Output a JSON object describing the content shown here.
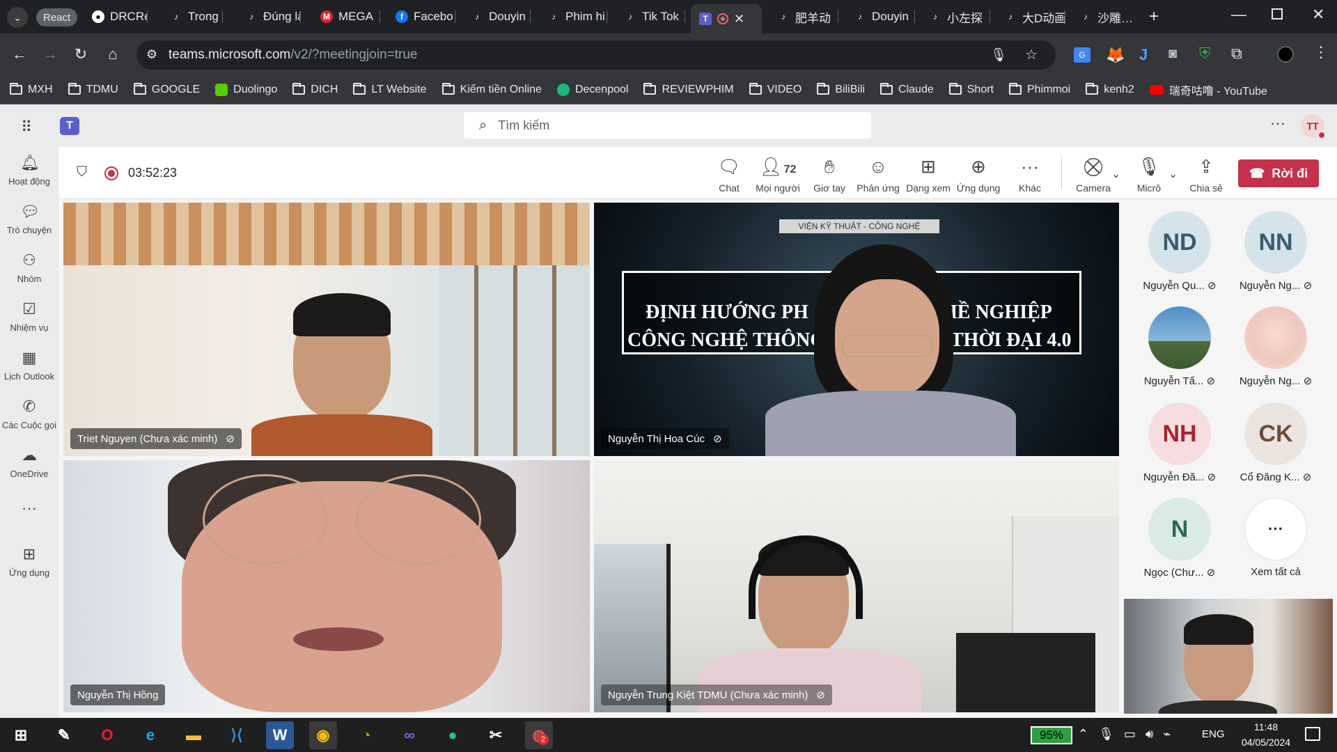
{
  "browser": {
    "tab_pill": "React",
    "tabs": [
      {
        "label": "DRCRec",
        "icon": "github-icon"
      },
      {
        "label": "Trong T",
        "icon": "tiktok-icon"
      },
      {
        "label": "Đúng là",
        "icon": "tiktok-icon"
      },
      {
        "label": "MEGA",
        "icon": "mega-icon"
      },
      {
        "label": "Facebo",
        "icon": "facebook-icon"
      },
      {
        "label": "Douyin",
        "icon": "tiktok-icon"
      },
      {
        "label": "Phim hi",
        "icon": "tiktok-icon"
      },
      {
        "label": "Tik Tok",
        "icon": "tiktok-icon"
      },
      {
        "label": "",
        "icon": "teams-icon"
      },
      {
        "label": "肥羊动",
        "icon": "tiktok-icon"
      },
      {
        "label": "Douyin",
        "icon": "tiktok-icon"
      },
      {
        "label": "小左探",
        "icon": "tiktok-icon"
      },
      {
        "label": "大D动画",
        "icon": "tiktok-icon"
      },
      {
        "label": "沙雕…",
        "icon": "tiktok-icon"
      }
    ],
    "url_host": "teams.microsoft.com",
    "url_path": "/v2/?meetingjoin=true",
    "bookmarks": [
      {
        "label": "MXH",
        "icon": "folder-icon"
      },
      {
        "label": "TDMU",
        "icon": "folder-icon"
      },
      {
        "label": "GOOGLE",
        "icon": "folder-icon"
      },
      {
        "label": "Duolingo",
        "icon": "duolingo-icon"
      },
      {
        "label": "DICH",
        "icon": "folder-icon"
      },
      {
        "label": "LT Website",
        "icon": "folder-icon"
      },
      {
        "label": "Kiếm tiền Online",
        "icon": "folder-icon"
      },
      {
        "label": "Decenpool",
        "icon": "decenpool-icon"
      },
      {
        "label": "REVIEWPHIM",
        "icon": "folder-icon"
      },
      {
        "label": "VIDEO",
        "icon": "folder-icon"
      },
      {
        "label": "BiliBili",
        "icon": "folder-icon"
      },
      {
        "label": "Claude",
        "icon": "folder-icon"
      },
      {
        "label": "Short",
        "icon": "folder-icon"
      },
      {
        "label": "Phimmoi",
        "icon": "folder-icon"
      },
      {
        "label": "kenh2",
        "icon": "folder-icon"
      },
      {
        "label": "瑞奇咕噜 - YouTube",
        "icon": "youtube-icon"
      }
    ]
  },
  "teams": {
    "search_placeholder": "Tìm kiếm",
    "user_initials": "TT",
    "rail": [
      {
        "label": "Hoạt động",
        "icon": "bell-icon"
      },
      {
        "label": "Trò chuyện",
        "icon": "chat-icon"
      },
      {
        "label": "Nhóm",
        "icon": "teams-group-icon"
      },
      {
        "label": "Nhiệm vụ",
        "icon": "tasks-icon"
      },
      {
        "label": "Lịch Outlook",
        "icon": "calendar-icon"
      },
      {
        "label": "Các Cuộc gọi",
        "icon": "phone-icon"
      },
      {
        "label": "OneDrive",
        "icon": "cloud-icon"
      },
      {
        "label": "",
        "icon": "more-icon"
      },
      {
        "label": "Ứng dụng",
        "icon": "add-app-icon"
      }
    ]
  },
  "meeting": {
    "timer": "03:52:23",
    "people_count": "72",
    "controls": {
      "chat": "Chat",
      "people": "Mọi người",
      "raise": "Giơ tay",
      "react": "Phản ứng",
      "view": "Dạng xem",
      "apps": "Ứng dụng",
      "more": "Khác",
      "camera": "Camera",
      "mic": "Micrô",
      "share": "Chia sẻ",
      "leave": "Rời đi"
    },
    "tiles": [
      {
        "name": "Triet Nguyen (Chưa xác minh)"
      },
      {
        "name": "Nguyễn Thị Hoa Cúc"
      },
      {
        "name": "Nguyễn Thị Hồng"
      },
      {
        "name": "Nguyễn Trung Kiệt TDMU (Chưa xác minh)"
      }
    ],
    "slide": {
      "banner": "VIỆN KỸ THUẬT - CÔNG NGHỆ",
      "line1": "ĐỊNH HƯỚNG PH",
      "line1b": "HỀ NGHIỆP",
      "line2": "CÔNG NGHỆ THÔNG",
      "line2b": "THỜI ĐẠI 4.0"
    },
    "roster": [
      {
        "initials": "ND",
        "name": "Nguyễn Qu...",
        "bg": "#d5e3ea",
        "fg": "#3b5b6c"
      },
      {
        "initials": "NN",
        "name": "Nguyễn Ng...",
        "bg": "#d5e3ea",
        "fg": "#3b5b6c"
      },
      {
        "initials": "",
        "name": "Nguyễn Tấ...",
        "bg": "#6a9fc6",
        "fg": "#fff"
      },
      {
        "initials": "",
        "name": "Nguyễn Ng...",
        "bg": "#f1d7d2",
        "fg": "#fff"
      },
      {
        "initials": "NH",
        "name": "Nguyễn Đă...",
        "bg": "#f6dde0",
        "fg": "#a4262c"
      },
      {
        "initials": "CK",
        "name": "Cổ Đăng K...",
        "bg": "#ece4df",
        "fg": "#6b4e3d"
      },
      {
        "initials": "N",
        "name": "Ngọc (Chư...",
        "bg": "#d9ebe4",
        "fg": "#2d6a4f"
      },
      {
        "initials": "···",
        "name": "Xem tất cả",
        "bg": "#ffffff",
        "fg": "#242424"
      }
    ]
  },
  "taskbar": {
    "battery": "95%",
    "lang": "ENG",
    "time": "11:48",
    "date": "04/05/2024",
    "badge": "2"
  }
}
